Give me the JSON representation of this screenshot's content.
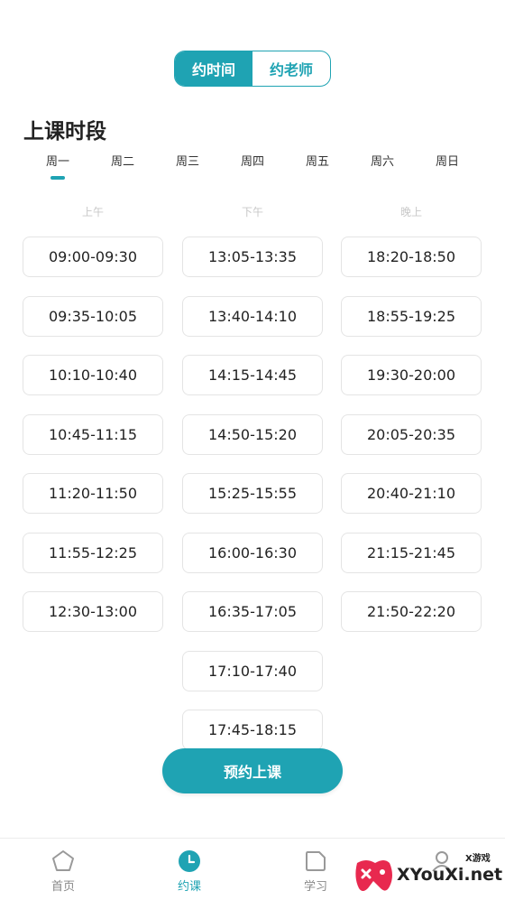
{
  "toggle": {
    "time_label": "约时间",
    "teacher_label": "约老师",
    "active": "time"
  },
  "section_title": "上课时段",
  "days": [
    {
      "label": "周一",
      "selected": true
    },
    {
      "label": "周二",
      "selected": false
    },
    {
      "label": "周三",
      "selected": false
    },
    {
      "label": "周四",
      "selected": false
    },
    {
      "label": "周五",
      "selected": false
    },
    {
      "label": "周六",
      "selected": false
    },
    {
      "label": "周日",
      "selected": false
    }
  ],
  "columns": [
    {
      "label": "上午",
      "slots": [
        "09:00-09:30",
        "09:35-10:05",
        "10:10-10:40",
        "10:45-11:15",
        "11:20-11:50",
        "11:55-12:25",
        "12:30-13:00"
      ]
    },
    {
      "label": "下午",
      "slots": [
        "13:05-13:35",
        "13:40-14:10",
        "14:15-14:45",
        "14:50-15:20",
        "15:25-15:55",
        "16:00-16:30",
        "16:35-17:05",
        "17:10-17:40",
        "17:45-18:15"
      ]
    },
    {
      "label": "晚上",
      "slots": [
        "18:20-18:50",
        "18:55-19:25",
        "19:30-20:00",
        "20:05-20:35",
        "20:40-21:10",
        "21:15-21:45",
        "21:50-22:20"
      ]
    }
  ],
  "book_button": "预约上课",
  "nav": [
    {
      "label": "首页",
      "icon": "home-pentagon-icon",
      "active": false
    },
    {
      "label": "约课",
      "icon": "clock-icon",
      "active": true
    },
    {
      "label": "学习",
      "icon": "study-icon",
      "active": false
    },
    {
      "label": "",
      "icon": "profile-icon",
      "active": false
    }
  ],
  "watermark": {
    "text": "XYouXi.net",
    "small": "X游戏"
  },
  "colors": {
    "accent": "#1fa3b3",
    "muted": "#c8c8c8",
    "border": "#e4e4e4"
  }
}
